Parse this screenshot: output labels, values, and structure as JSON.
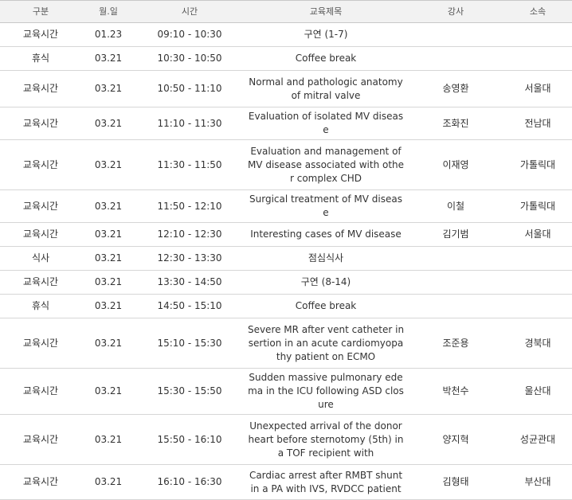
{
  "headers": {
    "category": "구분",
    "date": "월.일",
    "time": "시간",
    "title": "교육제목",
    "lecturer": "강사",
    "affiliation": "소속"
  },
  "rows": [
    {
      "category": "교육시간",
      "date": "01.23",
      "time": "09:10 - 10:30",
      "title": "구연 (1-7)",
      "lecturer": "",
      "affiliation": ""
    },
    {
      "category": "휴식",
      "date": "03.21",
      "time": "10:30 - 10:50",
      "title": "Coffee break",
      "lecturer": "",
      "affiliation": ""
    },
    {
      "category": "교육시간",
      "date": "03.21",
      "time": "10:50 - 11:10",
      "title": "Normal and pathologic anatomy of mitral valve",
      "lecturer": "송영환",
      "affiliation": "서울대"
    },
    {
      "category": "교육시간",
      "date": "03.21",
      "time": "11:10 - 11:30",
      "title": "Evaluation of isolated MV disease",
      "lecturer": "조화진",
      "affiliation": "전남대"
    },
    {
      "category": "교육시간",
      "date": "03.21",
      "time": "11:30 - 11:50",
      "title": "Evaluation and management of MV disease associated with other complex CHD",
      "lecturer": "이재영",
      "affiliation": "가톨릭대"
    },
    {
      "category": "교육시간",
      "date": "03.21",
      "time": "11:50 - 12:10",
      "title": "Surgical treatment of MV disease",
      "lecturer": "이철",
      "affiliation": "가톨릭대"
    },
    {
      "category": "교육시간",
      "date": "03.21",
      "time": "12:10 - 12:30",
      "title": "Interesting cases of MV disease",
      "lecturer": "김기범",
      "affiliation": "서울대"
    },
    {
      "category": "식사",
      "date": "03.21",
      "time": "12:30 - 13:30",
      "title": "점심식사",
      "lecturer": "",
      "affiliation": ""
    },
    {
      "category": "교육시간",
      "date": "03.21",
      "time": "13:30 - 14:50",
      "title": "구연 (8-14)",
      "lecturer": "",
      "affiliation": ""
    },
    {
      "category": "휴식",
      "date": "03.21",
      "time": "14:50 - 15:10",
      "title": "Coffee break",
      "lecturer": "",
      "affiliation": ""
    },
    {
      "category": "교육시간",
      "date": "03.21",
      "time": "15:10 - 15:30",
      "title": "Severe MR after vent catheter insertion in an acute cardiomyopathy patient on ECMO",
      "lecturer": "조준용",
      "affiliation": "경북대"
    },
    {
      "category": "교육시간",
      "date": "03.21",
      "time": "15:30 - 15:50",
      "title": "Sudden massive pulmonary edema in the ICU following ASD closure",
      "lecturer": "박천수",
      "affiliation": "울산대"
    },
    {
      "category": "교육시간",
      "date": "03.21",
      "time": "15:50 - 16:10",
      "title": "Unexpected arrival of the donor heart before sternotomy (5th) in a TOF recipient with",
      "lecturer": "양지혁",
      "affiliation": "성균관대"
    },
    {
      "category": "교육시간",
      "date": "03.21",
      "time": "16:10 - 16:30",
      "title": "Cardiac arrest after RMBT shunt in a PA with IVS, RVDCC patient",
      "lecturer": "김형태",
      "affiliation": "부산대"
    }
  ]
}
